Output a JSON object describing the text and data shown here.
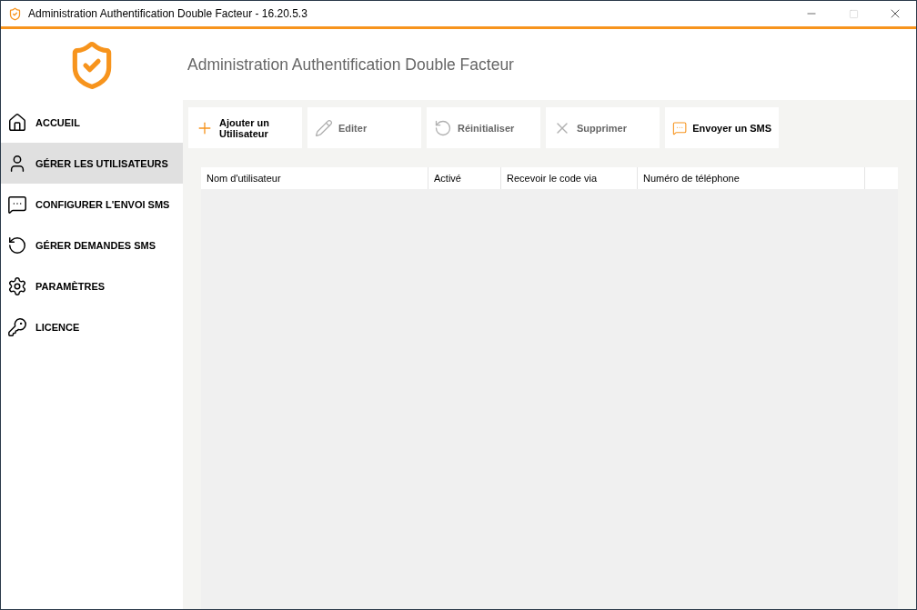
{
  "window": {
    "title": "Administration Authentification Double Facteur - 16.20.5.3"
  },
  "header": {
    "title": "Administration Authentification Double Facteur"
  },
  "sidebar": {
    "items": [
      {
        "label": "ACCUEIL",
        "kind": "home",
        "selected": false
      },
      {
        "label": "GÉRER LES UTILISATEURS",
        "kind": "user",
        "selected": true
      },
      {
        "label": "CONFIGURER L'ENVOI SMS",
        "kind": "message",
        "selected": false
      },
      {
        "label": "GÉRER DEMANDES SMS",
        "kind": "undo",
        "selected": false
      },
      {
        "label": "PARAMÈTRES",
        "kind": "settings",
        "selected": false
      },
      {
        "label": "LICENCE",
        "kind": "key",
        "selected": false
      }
    ]
  },
  "toolbar": [
    {
      "label": "Ajouter un Utilisateur",
      "kind": "add",
      "disabled": false
    },
    {
      "label": "Editer",
      "kind": "edit",
      "disabled": true
    },
    {
      "label": "Réinitialiser",
      "kind": "reset",
      "disabled": true
    },
    {
      "label": "Supprimer",
      "kind": "delete",
      "disabled": true
    },
    {
      "label": "Envoyer un SMS",
      "kind": "sms",
      "disabled": false
    }
  ],
  "table": {
    "columns": [
      "Nom d'utilisateur",
      "Activé",
      "Recevoir le code via",
      "Numéro de téléphone"
    ]
  }
}
